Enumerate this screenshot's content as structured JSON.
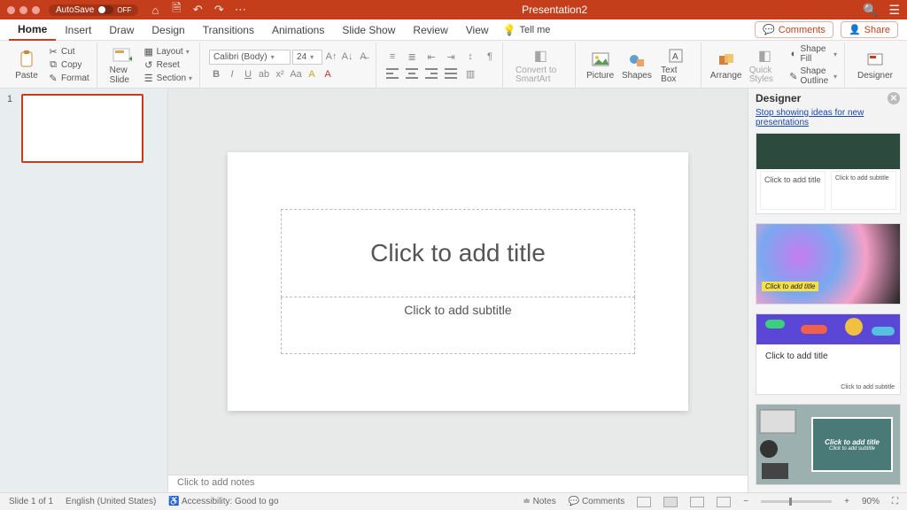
{
  "titlebar": {
    "autosave_label": "AutoSave",
    "autosave_state": "OFF",
    "document_title": "Presentation2"
  },
  "tabs": {
    "items": [
      "Home",
      "Insert",
      "Draw",
      "Design",
      "Transitions",
      "Animations",
      "Slide Show",
      "Review",
      "View"
    ],
    "active": "Home",
    "tell_me": "Tell me",
    "comments": "Comments",
    "share": "Share"
  },
  "ribbon": {
    "paste": "Paste",
    "cut": "Cut",
    "copy": "Copy",
    "format": "Format",
    "new_slide": "New Slide",
    "layout": "Layout",
    "reset": "Reset",
    "section": "Section",
    "font_name": "Calibri (Body)",
    "font_size": "24",
    "convert": "Convert to SmartArt",
    "picture": "Picture",
    "shapes": "Shapes",
    "text_box": "Text Box",
    "arrange": "Arrange",
    "quick_styles": "Quick Styles",
    "shape_fill": "Shape Fill",
    "shape_outline": "Shape Outline",
    "designer": "Designer"
  },
  "thumbs": {
    "slide1_num": "1"
  },
  "slide": {
    "title_placeholder": "Click to add title",
    "subtitle_placeholder": "Click to add subtitle"
  },
  "notes": {
    "placeholder": "Click to add notes"
  },
  "designer": {
    "title": "Designer",
    "stop_link": "Stop showing ideas for new presentations",
    "card1_title": "Click to add title",
    "card1_sub": "Click to add subtitle",
    "card2_title": "Click to add title",
    "card3_title": "Click to add title",
    "card3_sub": "Click to add subtitle",
    "card4_title": "Click to add title",
    "card4_sub": "Click to add subtitle"
  },
  "status": {
    "slide_counter": "Slide 1 of 1",
    "language": "English (United States)",
    "accessibility": "Accessibility: Good to go",
    "notes_btn": "Notes",
    "comments_btn": "Comments",
    "zoom_pct": "90%"
  }
}
